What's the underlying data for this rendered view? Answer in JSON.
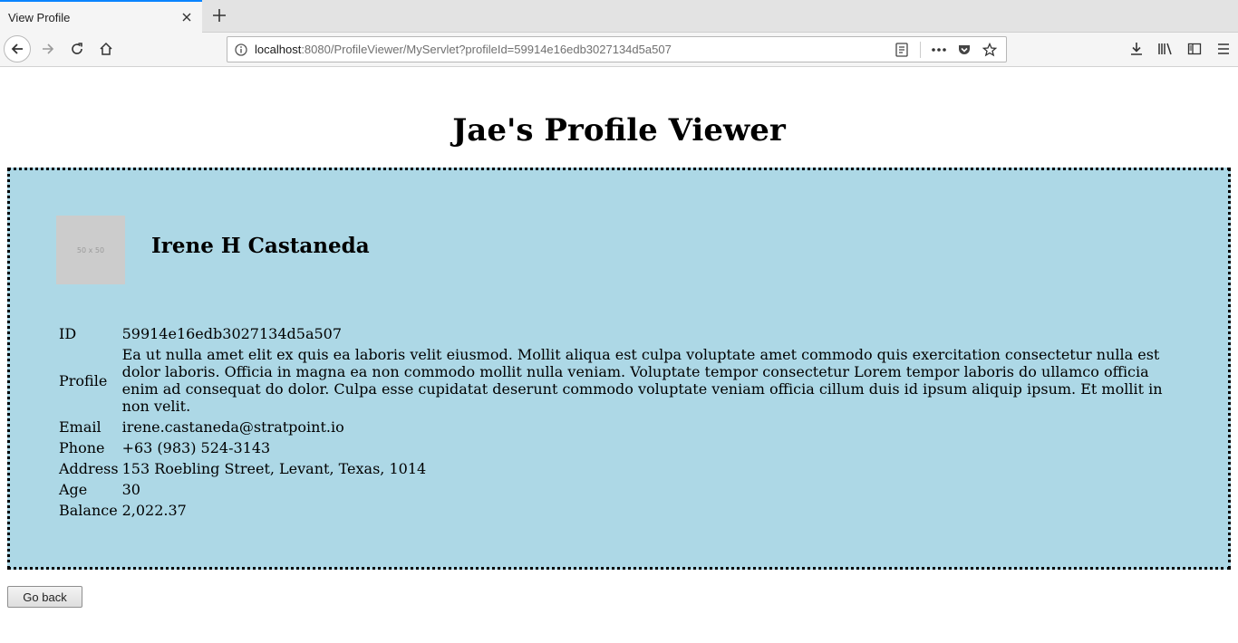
{
  "browser": {
    "tab_title": "View Profile",
    "url_host": "localhost",
    "url_path": ":8080/ProfileViewer/MyServlet?profileId=59914e16edb3027134d5a507"
  },
  "page": {
    "title": "Jae's Profile Viewer"
  },
  "profile": {
    "avatar_placeholder": "50 x 50",
    "name": "Irene H Castaneda",
    "fields": {
      "id_label": "ID",
      "id": "59914e16edb3027134d5a507",
      "profile_label": "Profile",
      "profile": "Ea ut nulla amet elit ex quis ea laboris velit eiusmod. Mollit aliqua est culpa voluptate amet commodo quis exercitation consectetur nulla est dolor laboris. Officia in magna ea non commodo mollit nulla veniam. Voluptate tempor consectetur Lorem tempor laboris do ullamco officia enim ad consequat do dolor. Culpa esse cupidatat deserunt commodo voluptate veniam officia cillum duis id ipsum aliquip ipsum. Et mollit in non velit.",
      "email_label": "Email",
      "email": "irene.castaneda@stratpoint.io",
      "phone_label": "Phone",
      "phone": "+63 (983) 524-3143",
      "address_label": "Address",
      "address": "153 Roebling Street, Levant, Texas, 1014",
      "age_label": "Age",
      "age": "30",
      "balance_label": "Balance",
      "balance": "2,022.37"
    }
  },
  "actions": {
    "go_back": "Go back"
  },
  "colors": {
    "card_background": "#add8e6",
    "tab_accent": "#0a84ff"
  }
}
